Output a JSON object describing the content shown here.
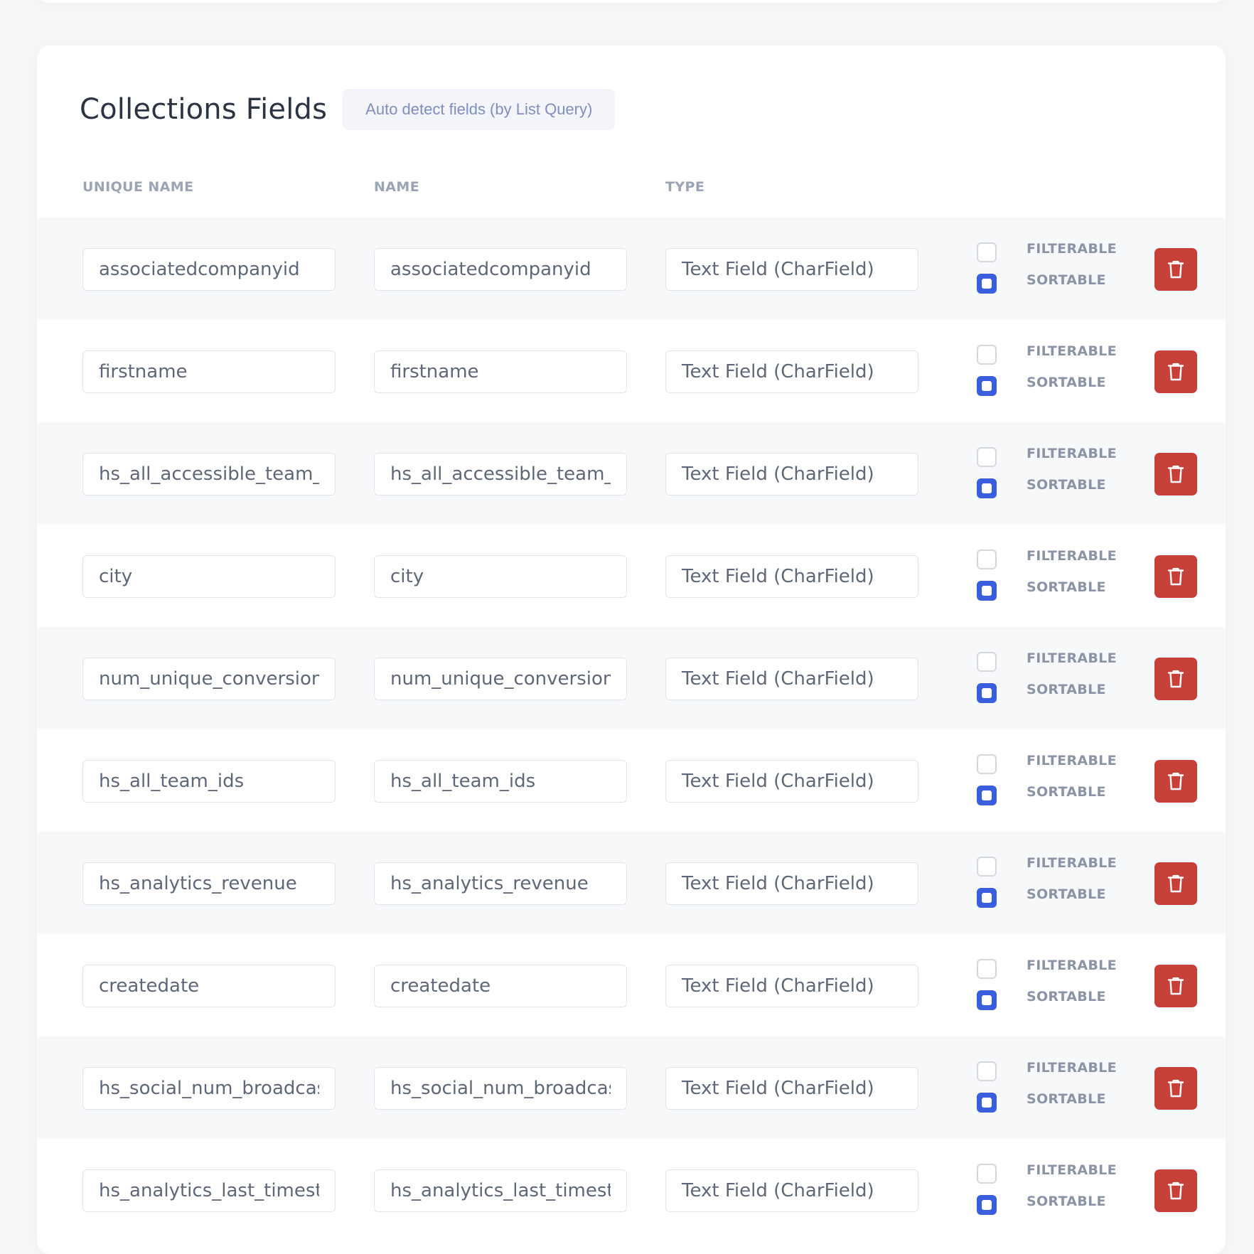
{
  "section": {
    "title": "Collections Fields",
    "auto_detect_label": "Auto detect fields (by List Query)"
  },
  "columns": {
    "unique_name": "UNIQUE NAME",
    "name": "NAME",
    "type": "TYPE"
  },
  "labels": {
    "filterable": "FILTERABLE",
    "sortable": "SORTABLE"
  },
  "rows": [
    {
      "unique_name": "associatedcompanyid",
      "name": "associatedcompanyid",
      "type": "Text Field (CharField)",
      "filterable": false,
      "sortable": true
    },
    {
      "unique_name": "firstname",
      "name": "firstname",
      "type": "Text Field (CharField)",
      "filterable": false,
      "sortable": true
    },
    {
      "unique_name": "hs_all_accessible_team_",
      "name": "hs_all_accessible_team_",
      "type": "Text Field (CharField)",
      "filterable": false,
      "sortable": true
    },
    {
      "unique_name": "city",
      "name": "city",
      "type": "Text Field (CharField)",
      "filterable": false,
      "sortable": true
    },
    {
      "unique_name": "num_unique_conversion",
      "name": "num_unique_conversion",
      "type": "Text Field (CharField)",
      "filterable": false,
      "sortable": true
    },
    {
      "unique_name": "hs_all_team_ids",
      "name": "hs_all_team_ids",
      "type": "Text Field (CharField)",
      "filterable": false,
      "sortable": true
    },
    {
      "unique_name": "hs_analytics_revenue",
      "name": "hs_analytics_revenue",
      "type": "Text Field (CharField)",
      "filterable": false,
      "sortable": true
    },
    {
      "unique_name": "createdate",
      "name": "createdate",
      "type": "Text Field (CharField)",
      "filterable": false,
      "sortable": true
    },
    {
      "unique_name": "hs_social_num_broadcas",
      "name": "hs_social_num_broadcas",
      "type": "Text Field (CharField)",
      "filterable": false,
      "sortable": true
    },
    {
      "unique_name": "hs_analytics_last_timest",
      "name": "hs_analytics_last_timest",
      "type": "Text Field (CharField)",
      "filterable": false,
      "sortable": true
    }
  ],
  "colors": {
    "accent": "#3a5fde",
    "danger": "#c6403a",
    "row_alt": "#f7f8fa"
  },
  "icons": {
    "delete": "trash-icon"
  }
}
